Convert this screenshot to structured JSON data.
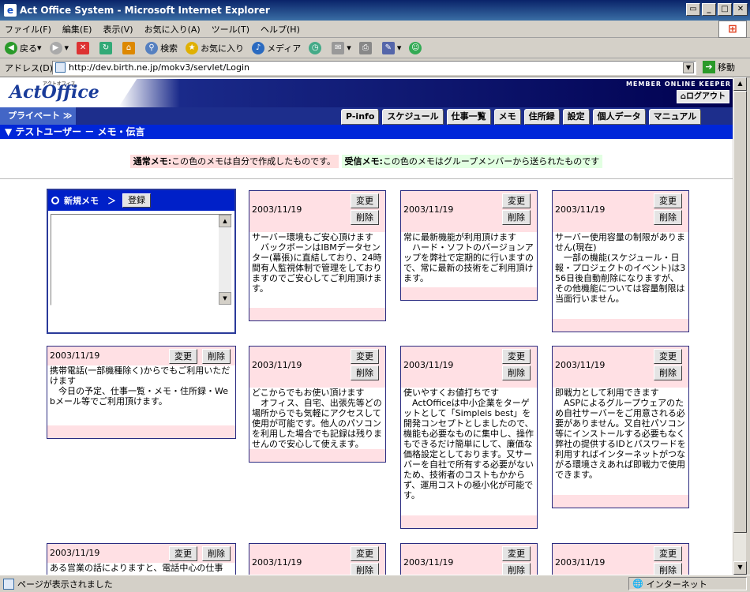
{
  "window": {
    "title": "Act Office System - Microsoft Internet Explorer"
  },
  "menu": [
    "ファイル(F)",
    "編集(E)",
    "表示(V)",
    "お気に入り(A)",
    "ツール(T)",
    "ヘルプ(H)"
  ],
  "toolbar": {
    "back": "戻る",
    "search": "検索",
    "favorites": "お気に入り",
    "media": "メディア"
  },
  "address": {
    "label": "アドレス(D)",
    "url": "http://dev.birth.ne.jp/mokv3/servlet/Login",
    "go": "移動"
  },
  "header": {
    "logo": "ActOffice",
    "logo_sub": "アクトオフィス",
    "tagline": "MEMBER ONLINE KEEPER",
    "logout": "ログアウト"
  },
  "nav": {
    "private": "プライベート",
    "tabs": [
      "P-info",
      "スケジュール",
      "仕事一覧",
      "メモ",
      "住所録",
      "設定",
      "個人データ",
      "マニュアル"
    ]
  },
  "section": {
    "title": "▼ テストユーザー － メモ・伝言"
  },
  "legend": {
    "normal_label": "通常メモ:",
    "normal_text": "この色のメモは自分で作成したものです。",
    "received_label": "受信メモ:",
    "received_text": "この色のメモはグループメンバーから送られたものです"
  },
  "new_memo": {
    "title": "新規メモ　＞",
    "register": "登録"
  },
  "buttons": {
    "edit": "変更",
    "delete": "削除"
  },
  "memos": [
    {
      "date": "2003/11/19",
      "text": "サーバー環境もご安心頂けます\n　バックボーンはIBMデータセンター(幕張)に直結しており、24時間有人監視体制で管理をしておりますのでご安心してご利用頂けます。"
    },
    {
      "date": "2003/11/19",
      "text": "常に最新機能が利用頂けます\n　ハード・ソフトのバージョンアップを弊社で定期的に行いますので、常に最新の技術をご利用頂けます。"
    },
    {
      "date": "2003/11/19",
      "text": "サーバー使用容量の制限がありません(現在)\n　一部の機能(スケジュール・日報・プロジェクトのイベント)は356日後自動削除になりますが、その他機能については容量制限は当面行いません。"
    },
    {
      "date": "2003/11/19",
      "text": "携帯電話(一部機種除く)からでもご利用いただけます\n　今日の予定、仕事一覧・メモ・住所録・Webメール等でご利用頂けます。"
    },
    {
      "date": "2003/11/19",
      "text": "どこからでもお使い頂けます\n　オフィス、自宅、出張先等どの場所からでも気軽にアクセスして使用が可能です。他人のパソコンを利用した場合でも記録は残りませんので安心して使えます。"
    },
    {
      "date": "2003/11/19",
      "text": "使いやすくお値打ちです\n　ActOfficeは中小企業をターゲットとして「Simpleis best」を開発コンセプトとしましたので、機能も必要なものに集中し、操作もできるだけ簡単にして、廉価な価格設定としております。又サーバーを自社で所有する必要がないため、技術者のコストもかからず、運用コストの極小化が可能です。"
    },
    {
      "date": "2003/11/19",
      "text": "即戦力として利用できます\n　ASPによるグループウェアのため自社サーバーをご用意される必要がありません。又自社パソコン等にインストールする必要もなく弊社の提供するIDとパスワードを利用すればインターネットがつながる環境さえあれば即戦力で使用できます。"
    },
    {
      "date": "2003/11/19",
      "text": "ある営業の話によりますと、電話中心の仕事"
    },
    {
      "date": "2003/11/19",
      "text": ""
    },
    {
      "date": "2003/11/19",
      "text": ""
    },
    {
      "date": "2003/11/19",
      "text": ""
    }
  ],
  "status": {
    "text": "ページが表示されました",
    "zone": "インターネット"
  }
}
